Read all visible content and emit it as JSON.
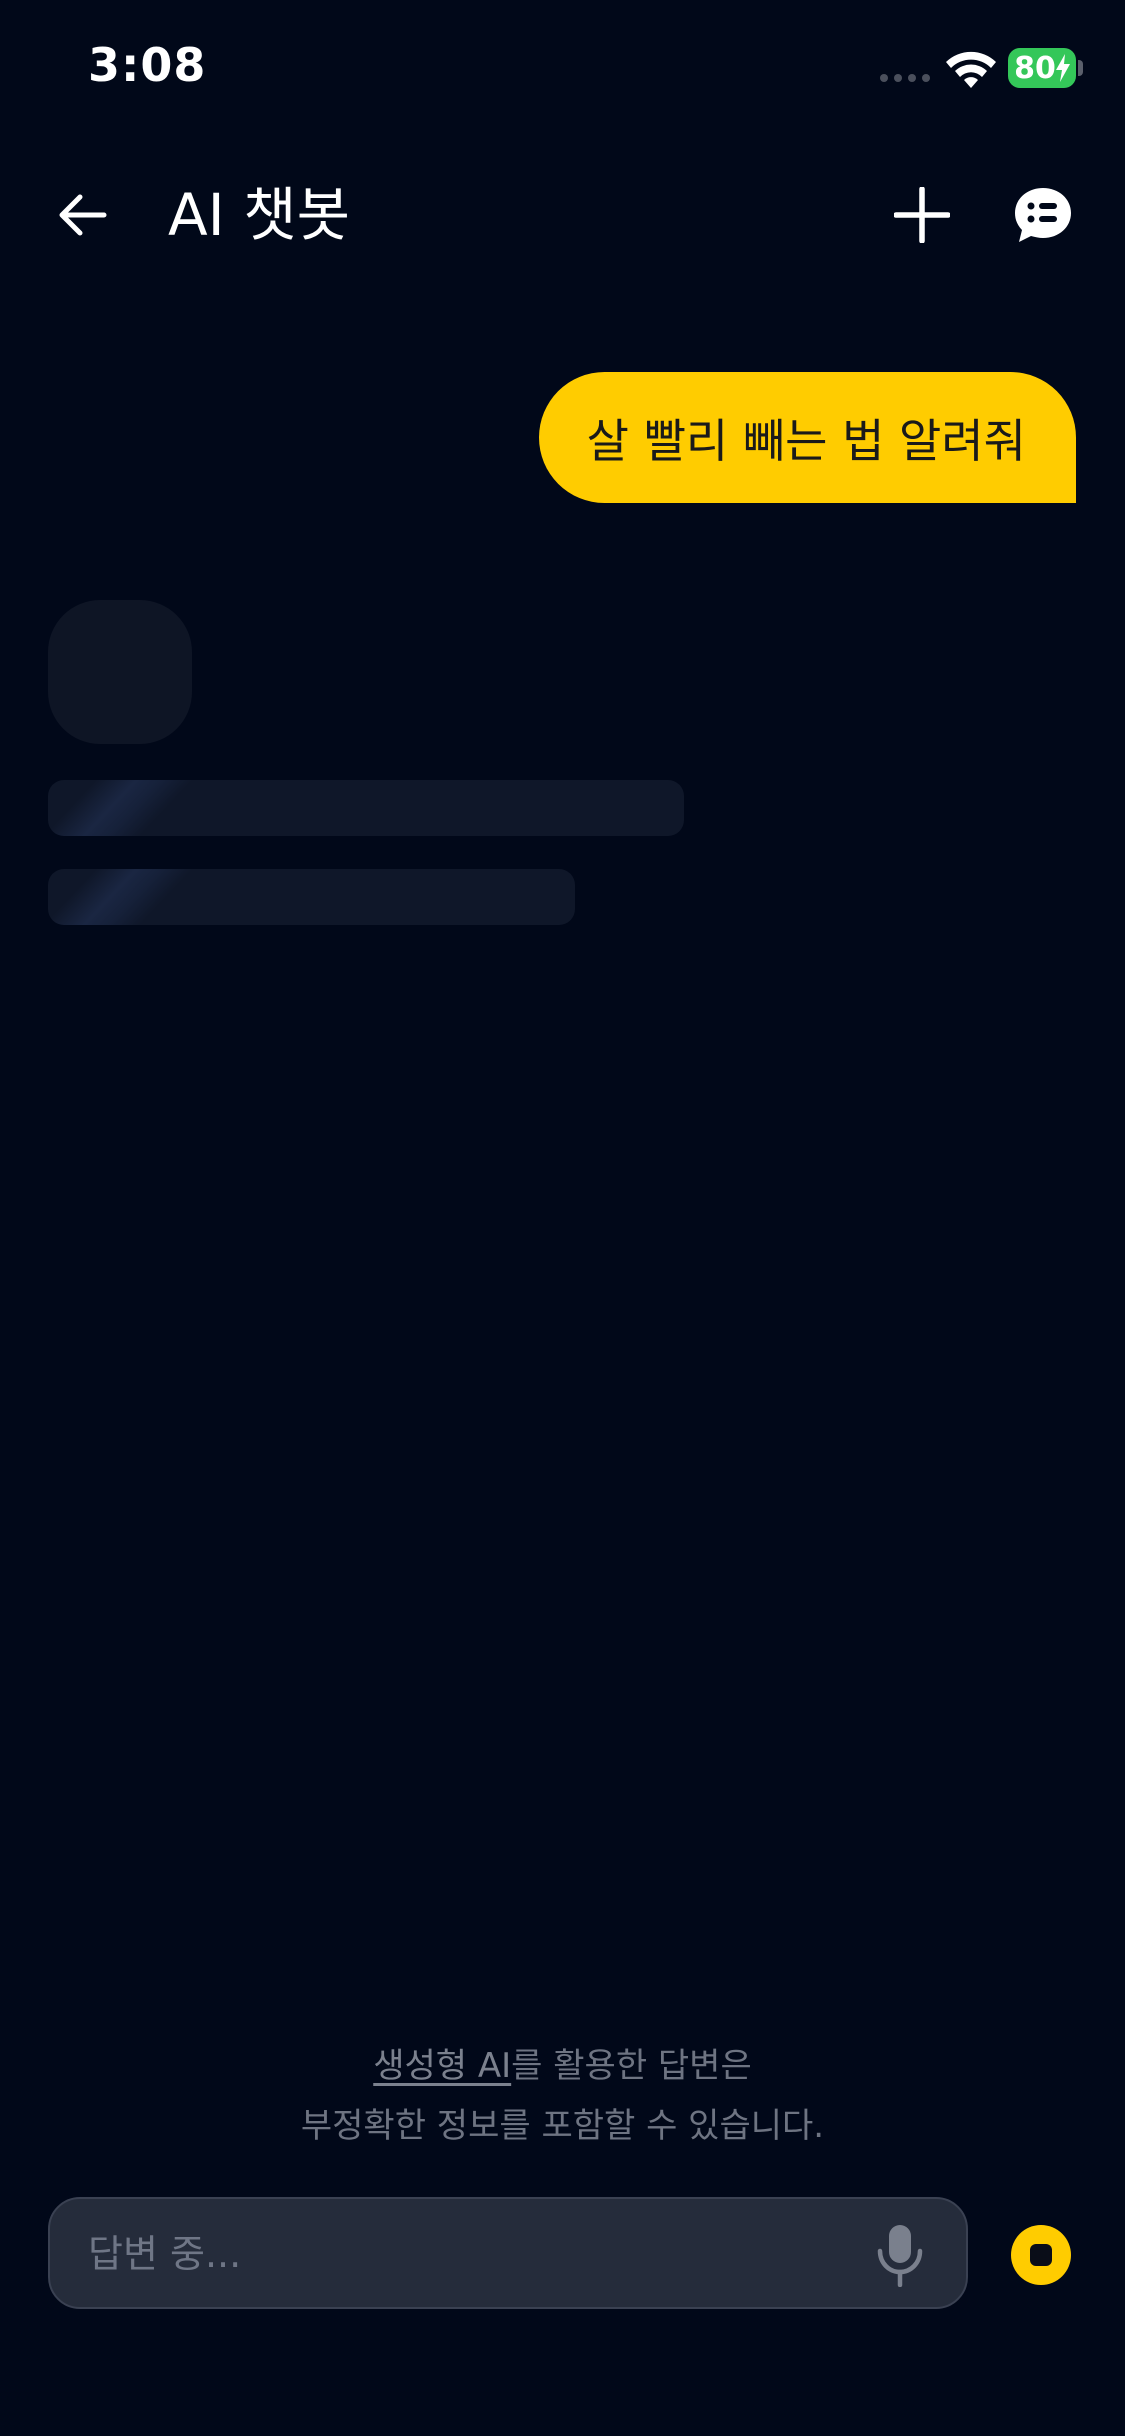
{
  "status_bar": {
    "time": "3:08",
    "battery_level": "80"
  },
  "header": {
    "title": "AI 챗봇"
  },
  "messages": [
    {
      "role": "user",
      "text": "살 빨리 빼는 법 알려줘"
    }
  ],
  "assistant": {
    "state": "loading"
  },
  "disclaimer": {
    "link_text": "생성형 AI",
    "line1_rest": "를 활용한 답변은",
    "line2": "부정확한 정보를 포함할 수 있습니다."
  },
  "composer": {
    "placeholder": "답변 중..."
  },
  "colors": {
    "background": "#010819",
    "accent": "#ffcc00",
    "battery": "#34c759"
  }
}
